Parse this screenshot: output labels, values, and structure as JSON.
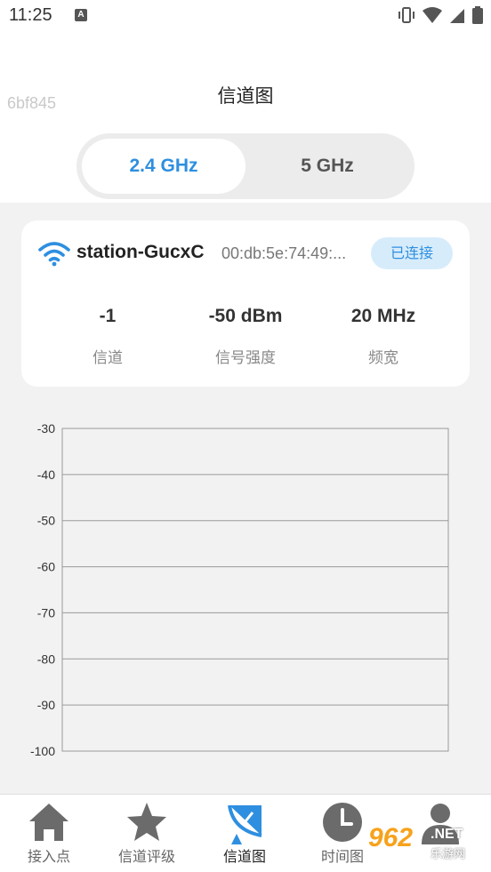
{
  "status_bar": {
    "time": "11:25",
    "notification_letter": "A"
  },
  "header": {
    "device_id": "6bf845",
    "title": "信道图"
  },
  "band_toggle": {
    "options": [
      "2.4 GHz",
      "5 GHz"
    ],
    "selected": "2.4 GHz"
  },
  "network_card": {
    "ssid": "station-GucxC",
    "bssid": "00:db:5e:74:49:...",
    "status_badge": "已连接",
    "stats": [
      {
        "value": "-1",
        "label": "信道"
      },
      {
        "value": "-50 dBm",
        "label": "信号强度"
      },
      {
        "value": "20 MHz",
        "label": "频宽"
      }
    ]
  },
  "chart_data": {
    "type": "line",
    "title": "",
    "xlabel": "",
    "ylabel": "",
    "ylim": [
      -100,
      -30
    ],
    "y_ticks": [
      "-30",
      "-40",
      "-50",
      "-60",
      "-70",
      "-80",
      "-90",
      "-100"
    ],
    "series": [],
    "grid": true
  },
  "bottom_nav": {
    "items": [
      {
        "label": "接入点",
        "icon": "home-icon",
        "active": false
      },
      {
        "label": "信道评级",
        "icon": "star-icon",
        "active": false
      },
      {
        "label": "信道图",
        "icon": "satellite-dish-icon",
        "active": true
      },
      {
        "label": "时间图",
        "icon": "clock-icon",
        "active": false
      },
      {
        "label": "",
        "icon": "person-icon",
        "active": false
      }
    ]
  },
  "watermark": {
    "brand": "962",
    "suffix": ".NET",
    "chinese": "乐游网"
  },
  "colors": {
    "accent": "#2e8fe0",
    "badge_bg": "#d7ecfb",
    "nav_icon": "#6b6b6b",
    "nav_icon_active": "#2e8fe0",
    "background": "#f2f2f2"
  }
}
